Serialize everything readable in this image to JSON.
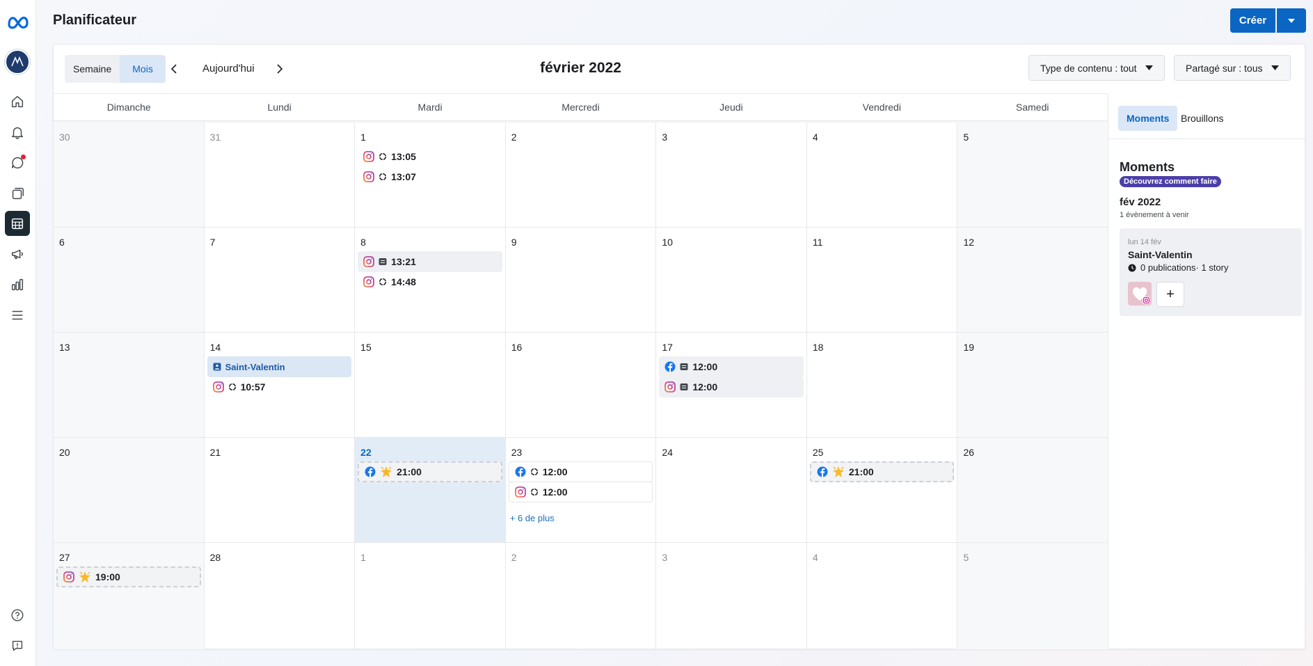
{
  "app": {
    "title": "Planificateur",
    "create_label": "Créer"
  },
  "colors": {
    "accent": "#0a66c2",
    "today_bg": "#e1ecf7",
    "pill": "#4b3fa7"
  },
  "rail": {
    "items": [
      {
        "name": "home-icon"
      },
      {
        "name": "bell-icon"
      },
      {
        "name": "chat-icon",
        "badge": true
      },
      {
        "name": "content-icon"
      },
      {
        "name": "calendar-icon",
        "active": true
      },
      {
        "name": "megaphone-icon"
      },
      {
        "name": "insights-icon"
      },
      {
        "name": "menu-icon"
      }
    ],
    "bottom": [
      {
        "name": "help-icon"
      },
      {
        "name": "report-icon"
      }
    ]
  },
  "toolbar": {
    "view_week": "Semaine",
    "view_month": "Mois",
    "today": "Aujourd'hui",
    "month_title": "février 2022",
    "filter_content": "Type de contenu : tout",
    "filter_share": "Partagé sur : tous"
  },
  "weekdays": [
    "Dimanche",
    "Lundi",
    "Mardi",
    "Mercredi",
    "Jeudi",
    "Vendredi",
    "Samedi"
  ],
  "weeks": [
    [
      {
        "day": "30",
        "muted": true
      },
      {
        "day": "31",
        "muted": true
      },
      {
        "day": "1",
        "events": [
          {
            "platform": "instagram",
            "status": "scheduled",
            "time": "13:05",
            "style": "plain"
          },
          {
            "platform": "instagram",
            "status": "scheduled",
            "time": "13:07",
            "style": "plain"
          }
        ]
      },
      {
        "day": "2"
      },
      {
        "day": "3"
      },
      {
        "day": "4"
      },
      {
        "day": "5"
      }
    ],
    [
      {
        "day": "6"
      },
      {
        "day": "7"
      },
      {
        "day": "8",
        "events": [
          {
            "platform": "instagram",
            "status": "published",
            "time": "13:21",
            "style": "gray"
          },
          {
            "platform": "instagram",
            "status": "scheduled",
            "time": "14:48",
            "style": "plain"
          }
        ]
      },
      {
        "day": "9"
      },
      {
        "day": "10"
      },
      {
        "day": "11"
      },
      {
        "day": "12"
      }
    ],
    [
      {
        "day": "13"
      },
      {
        "day": "14",
        "events": [
          {
            "platform": "moment",
            "label": "Saint-Valentin",
            "style": "blue"
          },
          {
            "platform": "instagram",
            "status": "scheduled",
            "time": "10:57",
            "style": "plain"
          }
        ]
      },
      {
        "day": "15"
      },
      {
        "day": "16"
      },
      {
        "day": "17",
        "events": [
          {
            "platform": "facebook",
            "status": "published",
            "time": "12:00",
            "style": "gray"
          },
          {
            "platform": "instagram",
            "status": "published",
            "time": "12:00",
            "style": "gray"
          }
        ]
      },
      {
        "day": "18"
      },
      {
        "day": "19"
      }
    ],
    [
      {
        "day": "20"
      },
      {
        "day": "21"
      },
      {
        "day": "22",
        "today": true,
        "events": [
          {
            "platform": "facebook",
            "status": "suggested",
            "time": "21:00",
            "style": "dashed"
          }
        ]
      },
      {
        "day": "23",
        "more": "+ 6 de plus",
        "events": [
          {
            "platform": "facebook",
            "status": "scheduled",
            "time": "12:00",
            "style": "outline"
          },
          {
            "platform": "instagram",
            "status": "scheduled",
            "time": "12:00",
            "style": "outline"
          }
        ]
      },
      {
        "day": "24"
      },
      {
        "day": "25",
        "events": [
          {
            "platform": "facebook",
            "status": "suggested",
            "time": "21:00",
            "style": "dashed"
          }
        ]
      },
      {
        "day": "26"
      }
    ],
    [
      {
        "day": "27",
        "events": [
          {
            "platform": "instagram",
            "status": "suggested",
            "time": "19:00",
            "style": "dashed"
          }
        ]
      },
      {
        "day": "28"
      },
      {
        "day": "1",
        "muted": true
      },
      {
        "day": "2",
        "muted": true
      },
      {
        "day": "3",
        "muted": true
      },
      {
        "day": "4",
        "muted": true
      },
      {
        "day": "5",
        "muted": true
      }
    ]
  ],
  "side": {
    "tab_moments": "Moments",
    "tab_drafts": "Brouillons",
    "heading": "Moments",
    "pill": "Découvrez comment faire",
    "month": "fév 2022",
    "upcoming": "1 évènement à venir",
    "event": {
      "date": "lun 14 fév",
      "title": "Saint-Valentin",
      "stats": "0 publications· 1 story",
      "add": "+"
    }
  }
}
